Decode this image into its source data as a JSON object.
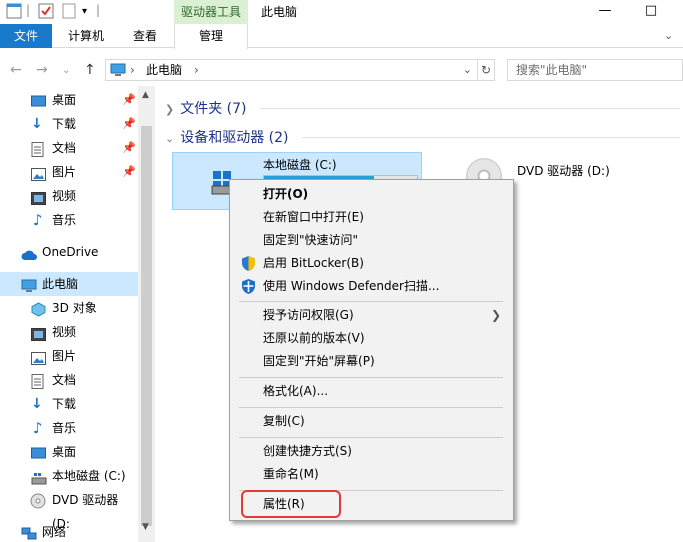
{
  "titlebar": {
    "tool_tab": "驱动器工具",
    "window_title": "此电脑",
    "minimize": "—",
    "maximize": "□"
  },
  "ribbon": {
    "tabs": [
      "文件",
      "计算机",
      "查看",
      "管理"
    ]
  },
  "address": {
    "path": "此电脑",
    "separator": "›",
    "search_placeholder": "搜索\"此电脑\""
  },
  "navpane": {
    "quick_access": [
      {
        "label": "桌面",
        "icon": "desktop-icon",
        "pinned": true
      },
      {
        "label": "下载",
        "icon": "download-icon",
        "pinned": true
      },
      {
        "label": "文档",
        "icon": "document-icon",
        "pinned": true
      },
      {
        "label": "图片",
        "icon": "pictures-icon",
        "pinned": true
      },
      {
        "label": "视频",
        "icon": "video-icon",
        "pinned": false
      },
      {
        "label": "音乐",
        "icon": "music-icon",
        "pinned": false
      }
    ],
    "onedrive": "OneDrive",
    "this_pc": "此电脑",
    "pc_items": [
      {
        "label": "3D 对象",
        "icon": "3d-objects-icon"
      },
      {
        "label": "视频",
        "icon": "video-icon"
      },
      {
        "label": "图片",
        "icon": "pictures-icon"
      },
      {
        "label": "文档",
        "icon": "document-icon"
      },
      {
        "label": "下载",
        "icon": "download-icon"
      },
      {
        "label": "音乐",
        "icon": "music-icon"
      },
      {
        "label": "桌面",
        "icon": "desktop-icon"
      },
      {
        "label": "本地磁盘 (C:)",
        "icon": "local-disk-icon"
      },
      {
        "label": "DVD 驱动器 (D:",
        "icon": "dvd-icon"
      }
    ],
    "network": "网络"
  },
  "main": {
    "folders_group": "文件夹 (7)",
    "devices_group": "设备和驱动器 (2)",
    "drive_c": {
      "name": "本地磁盘 (C:)",
      "usage_fraction": 0.72
    },
    "drive_d": {
      "name": "DVD 驱动器 (D:)"
    }
  },
  "context_menu": {
    "items": [
      {
        "label": "打开(O)",
        "bold": true
      },
      {
        "label": "在新窗口中打开(E)"
      },
      {
        "label": "固定到\"快速访问\""
      },
      {
        "label": "启用 BitLocker(B)",
        "icon": "shield-icon"
      },
      {
        "label": "使用 Windows Defender扫描...",
        "icon": "defender-icon"
      },
      {
        "label": "授予访问权限(G)",
        "submenu": true
      },
      {
        "label": "还原以前的版本(V)"
      },
      {
        "label": "固定到\"开始\"屏幕(P)"
      },
      {
        "label": "格式化(A)..."
      },
      {
        "label": "复制(C)"
      },
      {
        "label": "创建快捷方式(S)"
      },
      {
        "label": "重命名(M)"
      },
      {
        "label": "属性(R)"
      }
    ],
    "highlight_color": "#e53935"
  },
  "colors": {
    "accent": "#1979ca",
    "selection": "#cce8ff",
    "tool_tab_bg": "#dbf0d2",
    "group_header": "#1e3287"
  }
}
